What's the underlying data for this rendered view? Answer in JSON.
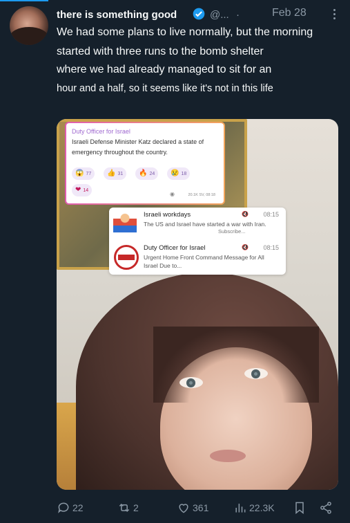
{
  "post": {
    "author_name": "there is something good",
    "handle": "@...",
    "separator": "·",
    "date": "Feb 28",
    "text_lines": [
      "We had some plans to live normally, but the morning",
      "started with three runs to the bomb shelter",
      "where we had already managed to sit for an",
      "hour and a half, so it seems like it's not in this life"
    ]
  },
  "media": {
    "channel_post": {
      "channel": "Duty Officer for Israel",
      "text": "Israeli Defense Minister Katz declared a state of emergency throughout the country.",
      "reactions": [
        {
          "icon": "😱",
          "count": "77"
        },
        {
          "icon": "👍",
          "count": "31"
        },
        {
          "icon": "🔥",
          "count": "24"
        },
        {
          "icon": "😢",
          "count": "18"
        },
        {
          "icon": "❤",
          "count": "14"
        }
      ],
      "meta": "20.1K SV, 08:18"
    },
    "notifications": [
      {
        "title": "Israeli workdays",
        "time": "08:15",
        "text": "The US and Israel have started a war with Iran.",
        "sub": "Subscribe..."
      },
      {
        "title": "Duty Officer for Israel",
        "time": "08:15",
        "text": "Urgent Home Front Command Message for All Israel Due to..."
      }
    ]
  },
  "actions": {
    "replies": "22",
    "reposts": "2",
    "likes": "361",
    "views": "22.3K"
  },
  "colors": {
    "background": "#15202b",
    "accent": "#1d9bf0",
    "muted": "#8b98a5"
  }
}
